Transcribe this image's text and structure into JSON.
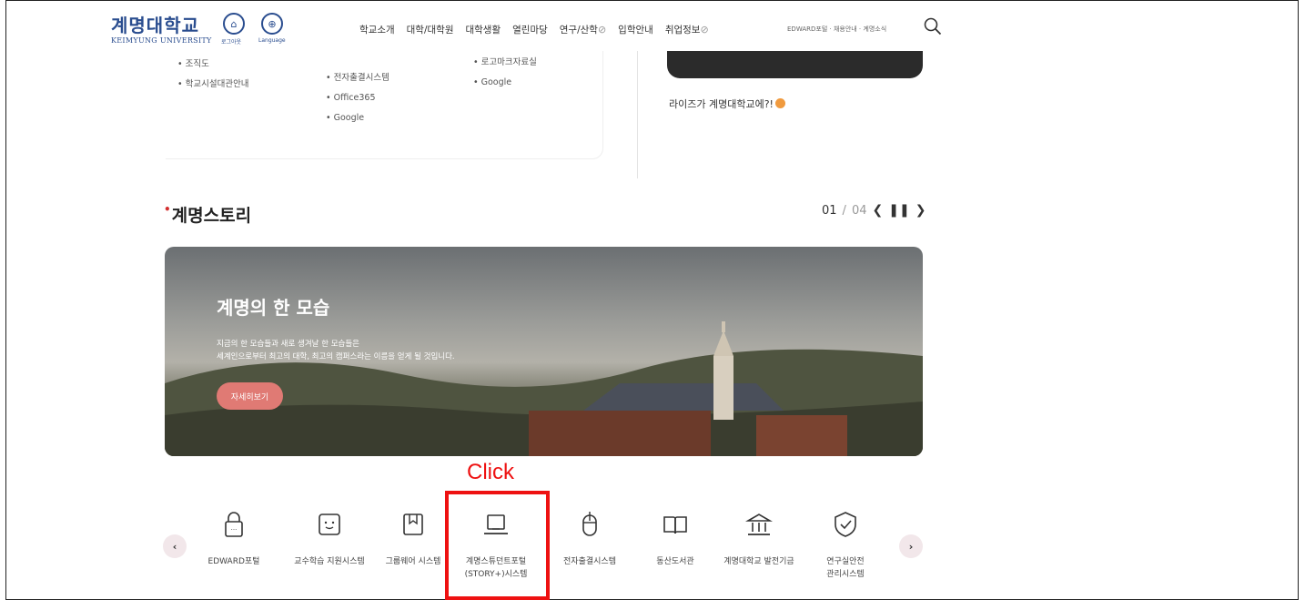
{
  "header": {
    "logo_ko": "계명대학교",
    "logo_en": "KEIMYUNG UNIVERSITY",
    "login_label": "로그아웃",
    "language_label": "Language",
    "nav": [
      "학교소개",
      "대학/대학원",
      "대학생활",
      "열린마당",
      "연구/산학",
      "입학안내",
      "취업정보"
    ],
    "util": "EDWARD포털 · 채용안내 · 계명소식"
  },
  "top_lists": {
    "col1": [
      "조직도",
      "학교시설대관안내"
    ],
    "col2": [
      "전자출결시스템",
      "Office365",
      "Google"
    ],
    "col3": [
      "로고마크자료실",
      "Google"
    ]
  },
  "card_caption": "라이즈가 계명대학교에?!",
  "story": {
    "title": "계명스토리",
    "pager_current": "01",
    "pager_total": "04",
    "banner_title": "계명의 한 모습",
    "banner_text": "지금의 한 모습들과 새로 생겨날 한 모습들은\n세계인으로부터 최고의 대학, 최고의 캠퍼스라는 이름을 얻게 될 것입니다.",
    "banner_button": "자세히보기"
  },
  "quick_links": [
    {
      "label": "EDWARD포털",
      "icon": "lock-icon"
    },
    {
      "label": "교수학습 지원시스템",
      "icon": "face-icon"
    },
    {
      "label": "그룹웨어 시스템",
      "icon": "bookmark-icon"
    },
    {
      "label": "계명스튜던트포털\n(STORY+)시스템",
      "icon": "laptop-icon"
    },
    {
      "label": "전자출결시스템",
      "icon": "mouse-icon"
    },
    {
      "label": "동산도서관",
      "icon": "book-icon"
    },
    {
      "label": "계명대학교 발전기금",
      "icon": "bank-icon"
    },
    {
      "label": "연구실안전\n관리시스템",
      "icon": "shield-check-icon"
    }
  ],
  "annotation": {
    "text": "Click",
    "color": "#ee1111"
  }
}
